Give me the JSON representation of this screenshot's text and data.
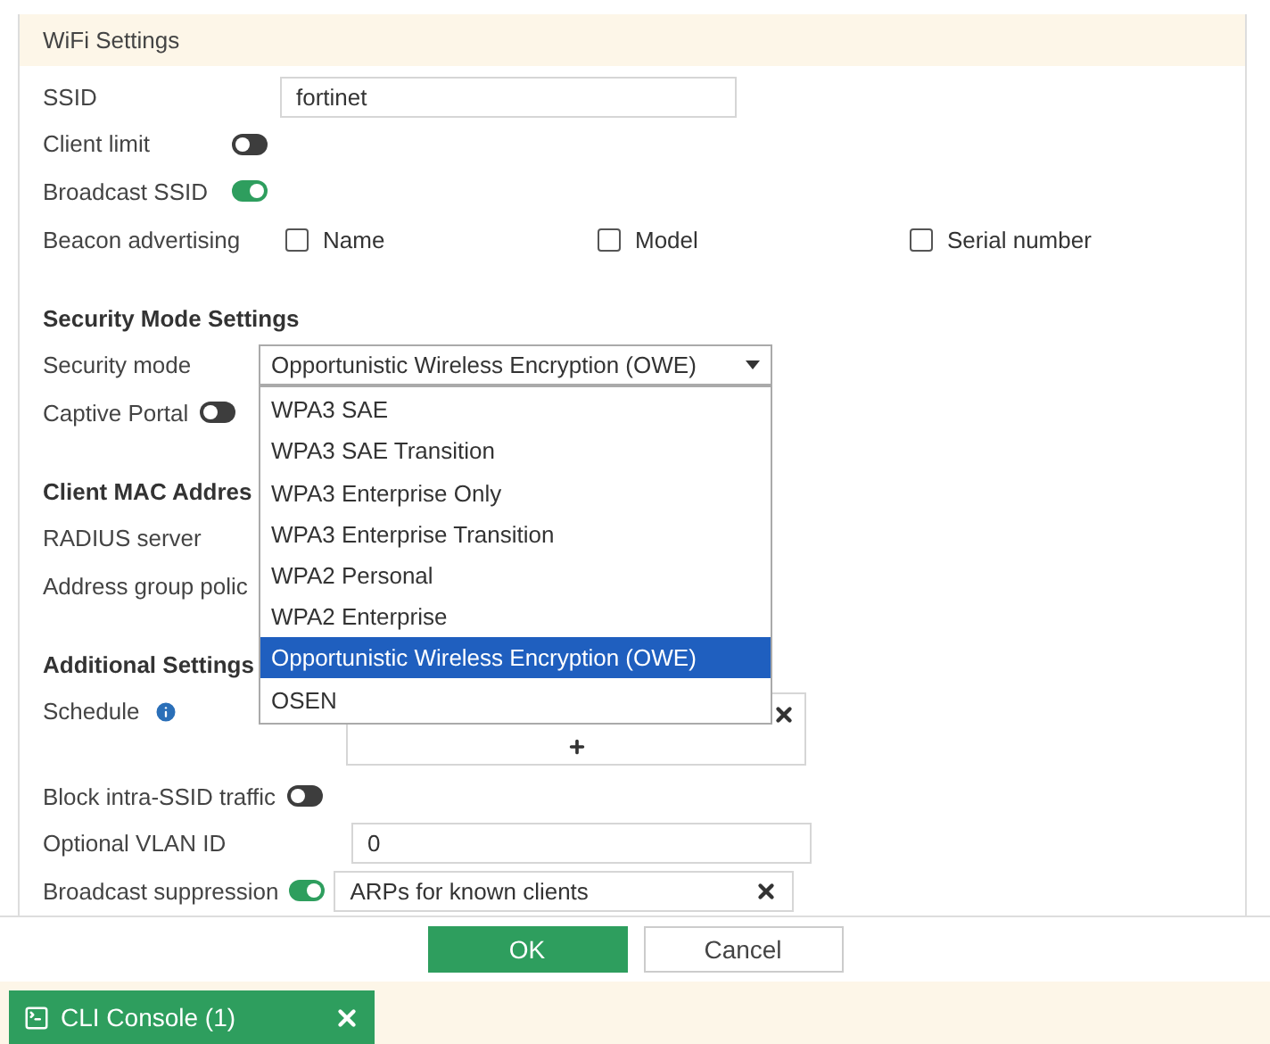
{
  "header": {
    "title": "WiFi Settings"
  },
  "sections": [
    {
      "rows": [
        {
          "kind": "input",
          "label": "SSID",
          "value": "fortinet"
        },
        {
          "kind": "toggle",
          "label": "Client limit",
          "on": false
        },
        {
          "kind": "toggle",
          "label": "Broadcast SSID",
          "on": true
        },
        {
          "kind": "checkboxes",
          "label": "Beacon advertising",
          "options": [
            {
              "label": "Name",
              "checked": false
            },
            {
              "label": "Model",
              "checked": false
            },
            {
              "label": "Serial number",
              "checked": false
            }
          ]
        }
      ]
    },
    {
      "title": "Security Mode Settings",
      "rows": [
        {
          "kind": "select",
          "label": "Security mode",
          "value": "Opportunistic Wireless Encryption (OWE)",
          "expanded": true,
          "options": [
            {
              "label": "WPA3 SAE",
              "selected": false
            },
            {
              "label": "WPA3 SAE Transition",
              "selected": false
            },
            {
              "label": "WPA3 Enterprise Only",
              "selected": false
            },
            {
              "label": "WPA3 Enterprise Transition",
              "selected": false
            },
            {
              "label": "WPA2 Personal",
              "selected": false
            },
            {
              "label": "WPA2 Enterprise",
              "selected": false
            },
            {
              "label": "Opportunistic Wireless Encryption (OWE)",
              "selected": true
            },
            {
              "label": "OSEN",
              "selected": false
            }
          ]
        },
        {
          "kind": "toggle",
          "label": "Captive Portal",
          "on": false
        }
      ]
    },
    {
      "title": "Client MAC Addres",
      "rows": [
        {
          "kind": "label",
          "label": "RADIUS server"
        },
        {
          "kind": "label",
          "label": "Address group polic"
        }
      ]
    },
    {
      "title": "Additional Settings",
      "rows": [
        {
          "kind": "schedule",
          "label": "Schedule"
        },
        {
          "kind": "toggle",
          "label": "Block intra-SSID traffic",
          "on": false
        },
        {
          "kind": "wideinput",
          "label": "Optional VLAN ID",
          "value": "0"
        },
        {
          "kind": "toggletag",
          "label": "Broadcast suppression",
          "on": true,
          "value": "ARPs for known clients"
        }
      ]
    }
  ],
  "buttons": [
    {
      "label": "OK",
      "kind": "primary"
    },
    {
      "label": "Cancel",
      "kind": "secondary"
    }
  ],
  "console_tab": {
    "label": "CLI Console (1)"
  }
}
